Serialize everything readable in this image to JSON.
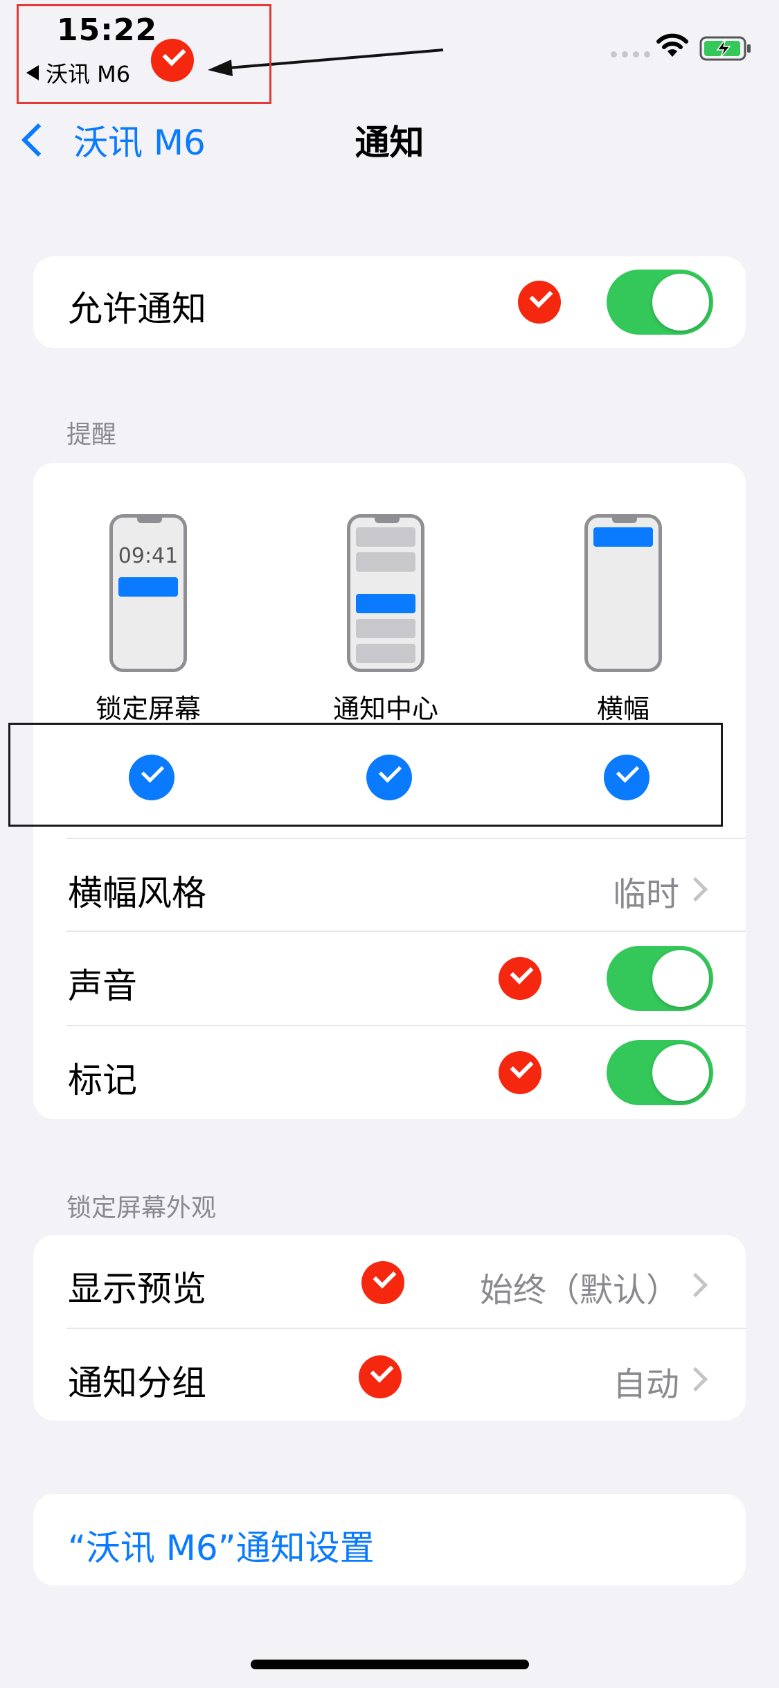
{
  "status_bar": {
    "time": "15:22",
    "back_app": "沃讯 M6"
  },
  "nav": {
    "back_label": "沃讯 M6",
    "title": "通知"
  },
  "allow": {
    "label": "允许通知",
    "toggle_on": true
  },
  "alerts": {
    "header": "提醒",
    "phone_time": "09:41",
    "options": [
      {
        "label": "锁定屏幕",
        "checked": true
      },
      {
        "label": "通知中心",
        "checked": true
      },
      {
        "label": "横幅",
        "checked": true
      }
    ],
    "banner_style": {
      "label": "横幅风格",
      "value": "临时"
    },
    "sounds": {
      "label": "声音",
      "toggle_on": true
    },
    "badges": {
      "label": "标记",
      "toggle_on": true
    }
  },
  "lock_screen": {
    "header": "锁定屏幕外观",
    "show_previews": {
      "label": "显示预览",
      "value": "始终（默认）"
    },
    "grouping": {
      "label": "通知分组",
      "value": "自动"
    }
  },
  "app_settings_link": "“沃讯 M6”通知设置",
  "colors": {
    "accent": "#0a7aff",
    "toggle_on": "#34c759",
    "annotation_red": "#f5270f"
  }
}
